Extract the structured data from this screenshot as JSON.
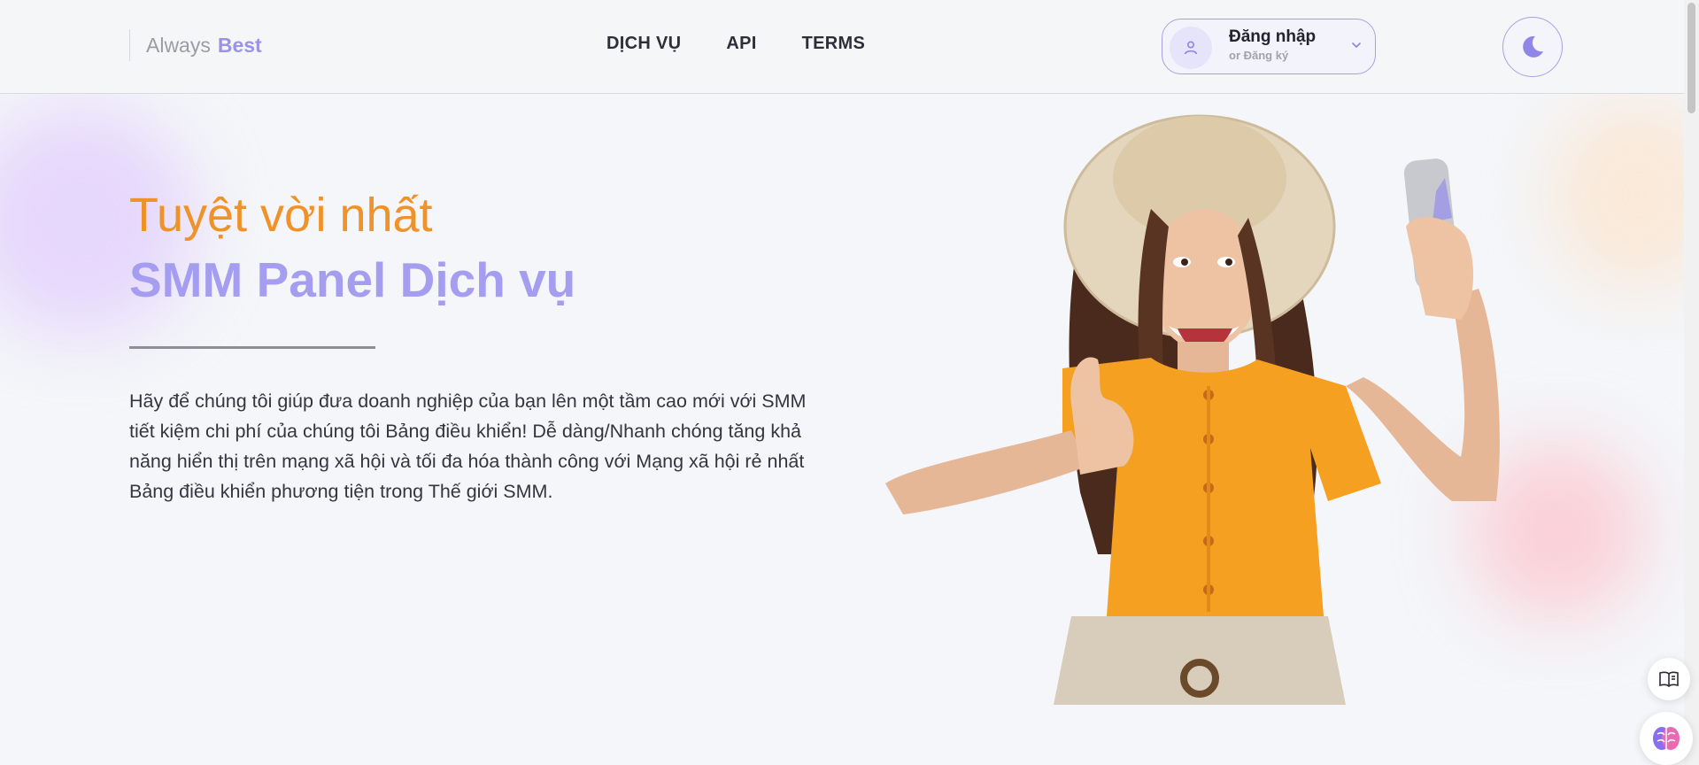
{
  "brand": {
    "prefix": "Always",
    "highlight": "Best"
  },
  "nav": {
    "items": [
      {
        "label": "DỊCH VỤ"
      },
      {
        "label": "API"
      },
      {
        "label": "TERMS"
      }
    ]
  },
  "account": {
    "login_label": "Đăng nhập",
    "register_label": "or Đăng ký"
  },
  "hero": {
    "title_line1": "Tuyệt vời nhất",
    "title_line2": "SMM Panel Dịch vụ",
    "description": "Hãy để chúng tôi giúp đưa doanh nghiệp của bạn lên một tầm cao mới với SMM tiết kiệm chi phí của chúng tôi Bảng điều khiển! Dễ dàng/Nhanh chóng tăng khả năng hiển thị trên mạng xã hội và tối đa hóa thành công với Mạng xã hội rẻ nhất Bảng điều khiển phương tiện trong Thế giới SMM."
  },
  "colors": {
    "accent_orange": "#f0922a",
    "accent_purple": "#a59df0",
    "background": "#f4f6f9"
  },
  "icons": {
    "avatar": "user-icon",
    "dropdown": "chevron-down-icon",
    "theme": "moon-icon",
    "docs": "book-icon",
    "assistant": "brain-icon"
  }
}
